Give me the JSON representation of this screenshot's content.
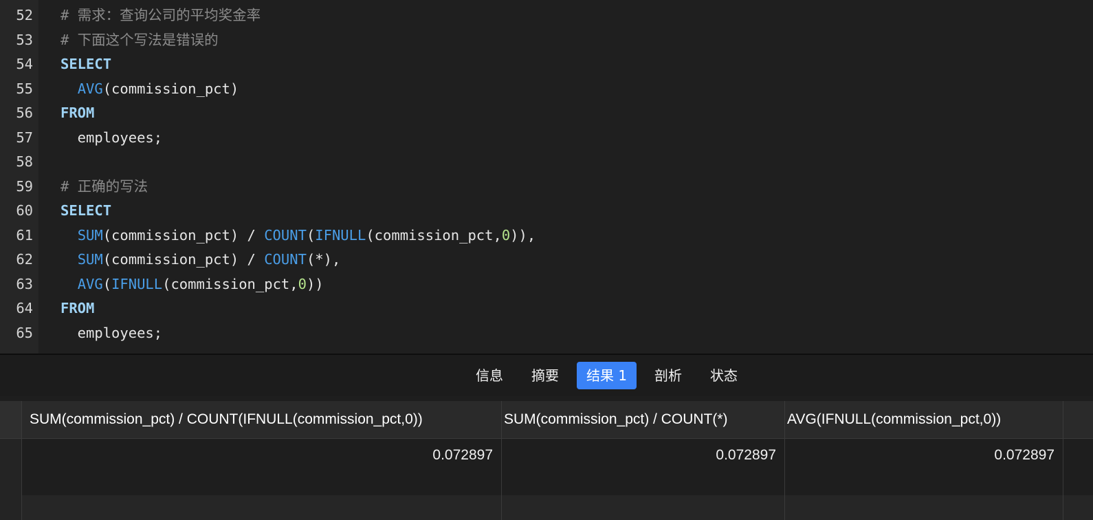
{
  "editor": {
    "lines": [
      {
        "num": "52",
        "tokens": [
          {
            "t": "comment",
            "v": "# 需求：查询公司的平均奖金率"
          }
        ]
      },
      {
        "num": "53",
        "tokens": [
          {
            "t": "comment",
            "v": "# 下面这个写法是错误的"
          }
        ]
      },
      {
        "num": "54",
        "tokens": [
          {
            "t": "keyword",
            "v": "SELECT"
          }
        ]
      },
      {
        "num": "55",
        "tokens": [
          {
            "t": "plain",
            "v": "  "
          },
          {
            "t": "func",
            "v": "AVG"
          },
          {
            "t": "plain",
            "v": "(commission_pct)"
          }
        ]
      },
      {
        "num": "56",
        "tokens": [
          {
            "t": "keyword",
            "v": "FROM"
          }
        ]
      },
      {
        "num": "57",
        "tokens": [
          {
            "t": "plain",
            "v": "  employees;"
          }
        ]
      },
      {
        "num": "58",
        "tokens": []
      },
      {
        "num": "59",
        "tokens": [
          {
            "t": "comment",
            "v": "# 正确的写法"
          }
        ]
      },
      {
        "num": "60",
        "tokens": [
          {
            "t": "keyword",
            "v": "SELECT"
          }
        ]
      },
      {
        "num": "61",
        "tokens": [
          {
            "t": "plain",
            "v": "  "
          },
          {
            "t": "func",
            "v": "SUM"
          },
          {
            "t": "plain",
            "v": "(commission_pct) / "
          },
          {
            "t": "func",
            "v": "COUNT"
          },
          {
            "t": "plain",
            "v": "("
          },
          {
            "t": "func",
            "v": "IFNULL"
          },
          {
            "t": "plain",
            "v": "(commission_pct,"
          },
          {
            "t": "num",
            "v": "0"
          },
          {
            "t": "plain",
            "v": ")),"
          }
        ]
      },
      {
        "num": "62",
        "tokens": [
          {
            "t": "plain",
            "v": "  "
          },
          {
            "t": "func",
            "v": "SUM"
          },
          {
            "t": "plain",
            "v": "(commission_pct) / "
          },
          {
            "t": "func",
            "v": "COUNT"
          },
          {
            "t": "plain",
            "v": "(*),"
          }
        ]
      },
      {
        "num": "63",
        "tokens": [
          {
            "t": "plain",
            "v": "  "
          },
          {
            "t": "func",
            "v": "AVG"
          },
          {
            "t": "plain",
            "v": "("
          },
          {
            "t": "func",
            "v": "IFNULL"
          },
          {
            "t": "plain",
            "v": "(commission_pct,"
          },
          {
            "t": "num",
            "v": "0"
          },
          {
            "t": "plain",
            "v": "))"
          }
        ]
      },
      {
        "num": "64",
        "tokens": [
          {
            "t": "keyword",
            "v": "FROM"
          }
        ]
      },
      {
        "num": "65",
        "tokens": [
          {
            "t": "plain",
            "v": "  employees;"
          }
        ]
      }
    ]
  },
  "tabs": [
    {
      "label": "信息",
      "active": false
    },
    {
      "label": "摘要",
      "active": false
    },
    {
      "label": "结果 1",
      "active": true
    },
    {
      "label": "剖析",
      "active": false
    },
    {
      "label": "状态",
      "active": false
    }
  ],
  "result": {
    "columns": [
      "SUM(commission_pct) / COUNT(IFNULL(commission_pct,0))",
      "SUM(commission_pct) / COUNT(*)",
      "AVG(IFNULL(commission_pct,0))"
    ],
    "rows": [
      [
        "0.072897",
        "0.072897",
        "0.072897"
      ]
    ]
  },
  "colors": {
    "active_tab": "#3a82f7",
    "keyword": "#9fd3f5",
    "function": "#4a9ee8",
    "number": "#b5e48c",
    "comment": "#8b8b8b"
  }
}
